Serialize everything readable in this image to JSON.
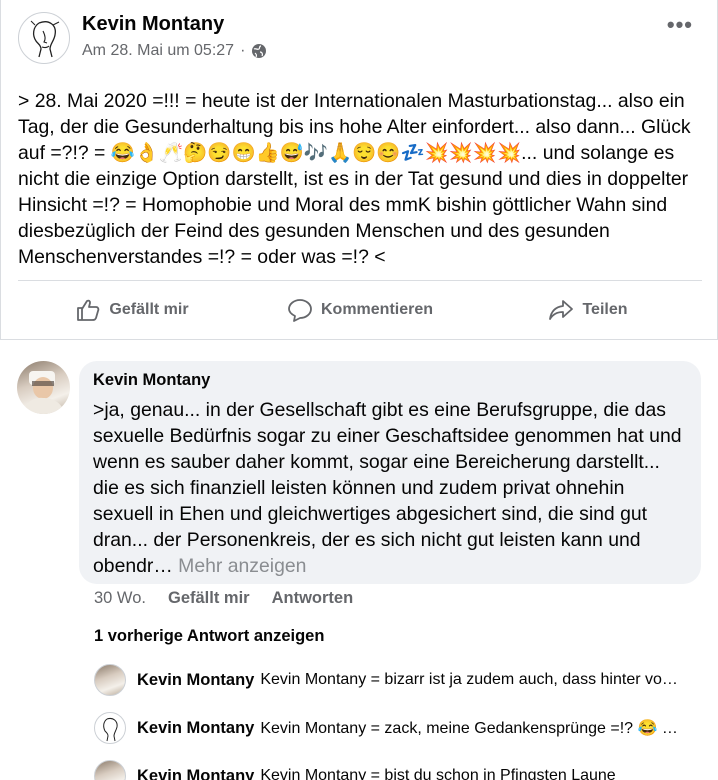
{
  "post": {
    "author": "Kevin Montany",
    "timestamp": "Am 28. Mai um 05:27",
    "separator": "·",
    "privacy_icon": "globe-icon",
    "more_label": "•••",
    "text": "> 28. Mai 2020 =!!! = heute ist der Internationalen Masturbationstag... also ein Tag, der die Gesunderhaltung bis ins hohe Alter einfordert... also dann... Glück auf =?!? = 😂👌🥂🤔😏😁👍😅🎶🙏😌😊💤💥💥💥💥... und solange es nicht die einzige Option darstellt, ist es in der Tat gesund und dies in doppelter Hinsicht =!? = Homophobie und Moral des mmK bishin göttlicher Wahn sind diesbezüglich der Feind des gesunden Menschen und des gesunden Menschenverstandes =!? = oder was =!? <"
  },
  "actions": {
    "like": "Gefällt mir",
    "comment": "Kommentieren",
    "share": "Teilen"
  },
  "comment": {
    "author": "Kevin Montany",
    "text": ">ja, genau... in der Gesellschaft gibt es eine Berufsgruppe, die das sexuelle Bedürfnis sogar zu einer Geschaftsidee genommen hat und wenn es sauber daher kommt, sogar eine Bereicherung darstellt... die es sich finanziell leisten können und zudem privat ohnehin sexuell in Ehen und gleichwertiges abgesichert sind, die sind gut dran... der Personenkreis, der es sich nicht gut leisten kann und obendr…",
    "more": "Mehr anzeigen",
    "time": "30 Wo.",
    "like": "Gefällt mir",
    "reply": "Antworten"
  },
  "previous_replies": "1 vorherige Antwort anzeigen",
  "replies": [
    {
      "name": "Kevin Montany",
      "text": "Kevin Montany = bizarr ist ja zudem auch, dass hinter vo…",
      "avatar": "photo"
    },
    {
      "name": "Kevin Montany",
      "text": "Kevin Montany = zack, meine  Gedankensprünge =!? 😂 …",
      "avatar": "sketch"
    },
    {
      "name": "Kevin Montany",
      "text": "Kevin Montany = bist du schon in Pfingsten Laune",
      "avatar": "photo"
    }
  ]
}
